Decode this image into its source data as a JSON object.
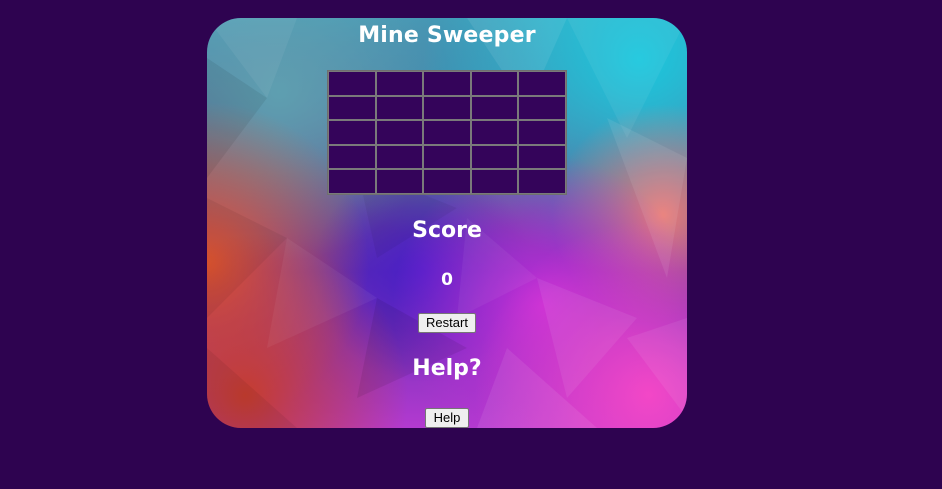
{
  "game": {
    "title": "Mine Sweeper",
    "score_label": "Score",
    "score_value": "0",
    "restart_label": "Restart",
    "help_heading": "Help?",
    "help_label": "Help",
    "grid": {
      "rows": 5,
      "cols": 5
    }
  },
  "colors": {
    "page_background": "#2e0350",
    "cell_background": "#34045a",
    "cell_border": "#7a7a7a",
    "text": "#ffffff"
  }
}
